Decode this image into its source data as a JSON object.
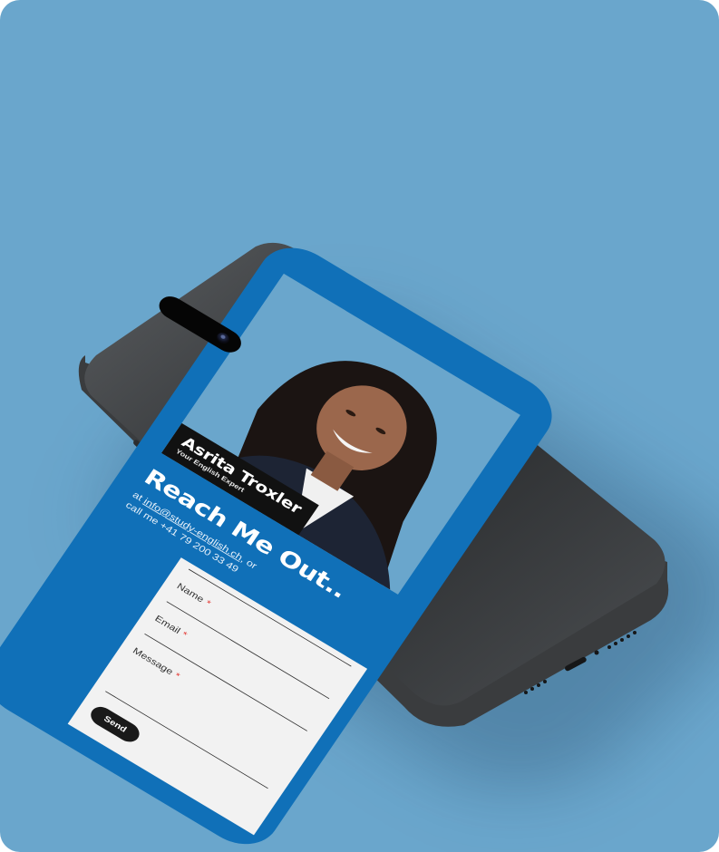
{
  "colors": {
    "background": "#6aa6cc",
    "screen_blue": "#1070b8",
    "frame": "#2f3133",
    "required_star": "#e3342f"
  },
  "profile": {
    "name": "Asrita Troxler",
    "tagline": "Your English Expert"
  },
  "contact": {
    "heading": "Reach Me Out..",
    "email_prefix": "at",
    "email": "info@study-english.ch",
    "email_suffix": "or",
    "phone_line": "call me +41 79 200 33 49"
  },
  "form": {
    "fields": [
      {
        "label": "Name",
        "required_mark": "*"
      },
      {
        "label": "Email",
        "required_mark": "*"
      },
      {
        "label": "Message",
        "required_mark": "*"
      }
    ],
    "send_label": "Send"
  },
  "icons": {
    "front_camera": "camera-lens-icon"
  }
}
